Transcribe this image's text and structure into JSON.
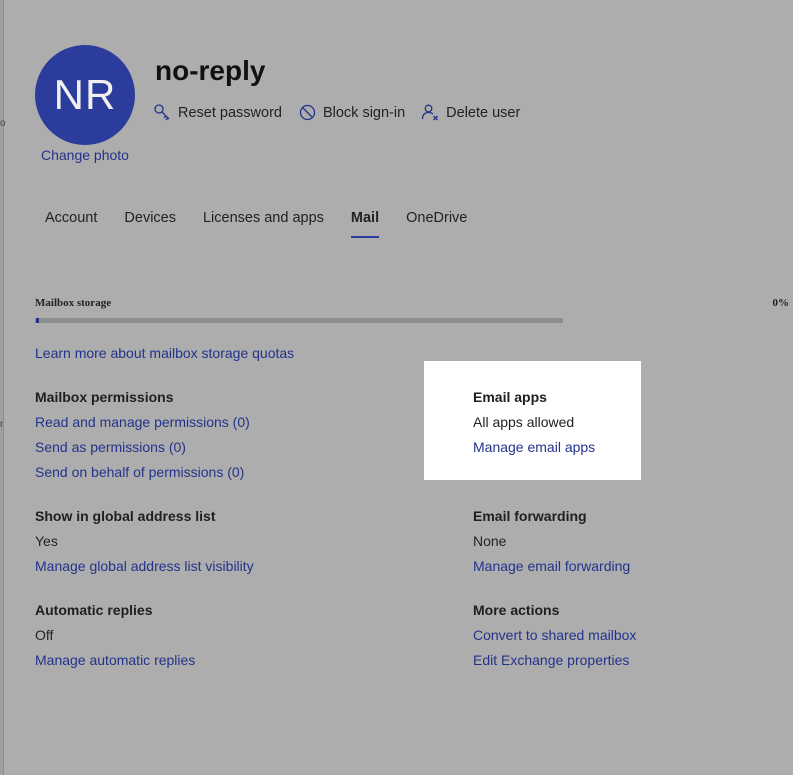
{
  "user": {
    "initials": "NR",
    "name": "no-reply",
    "change_photo": "Change photo"
  },
  "actions": {
    "reset_password": "Reset password",
    "block_signin": "Block sign-in",
    "delete_user": "Delete user"
  },
  "tabs": [
    {
      "label": "Account"
    },
    {
      "label": "Devices"
    },
    {
      "label": "Licenses and apps"
    },
    {
      "label": "Mail",
      "active": true
    },
    {
      "label": "OneDrive"
    }
  ],
  "storage": {
    "label": "Mailbox storage",
    "percent": "0%",
    "used_fraction": 0.005
  },
  "learn_more": "Learn more about mailbox storage quotas",
  "mailbox_permissions": {
    "heading": "Mailbox permissions",
    "links": [
      "Read and manage permissions (0)",
      "Send as permissions (0)",
      "Send on behalf of permissions (0)"
    ]
  },
  "email_apps": {
    "heading": "Email apps",
    "value": "All apps allowed",
    "link": "Manage email apps"
  },
  "global_address": {
    "heading": "Show in global address list",
    "value": "Yes",
    "link": "Manage global address list visibility"
  },
  "forwarding": {
    "heading": "Email forwarding",
    "value": "None",
    "link": "Manage email forwarding"
  },
  "auto_replies": {
    "heading": "Automatic replies",
    "value": "Off",
    "link": "Manage automatic replies"
  },
  "more_actions": {
    "heading": "More actions",
    "links": [
      "Convert to shared mailbox",
      "Edit Exchange properties"
    ]
  },
  "edge_marks": [
    "o",
    "r"
  ],
  "colors": {
    "accent": "#2b3c9c",
    "link": "#23338b",
    "overlay_bg": "#adadad",
    "highlight": "#ffffff"
  }
}
